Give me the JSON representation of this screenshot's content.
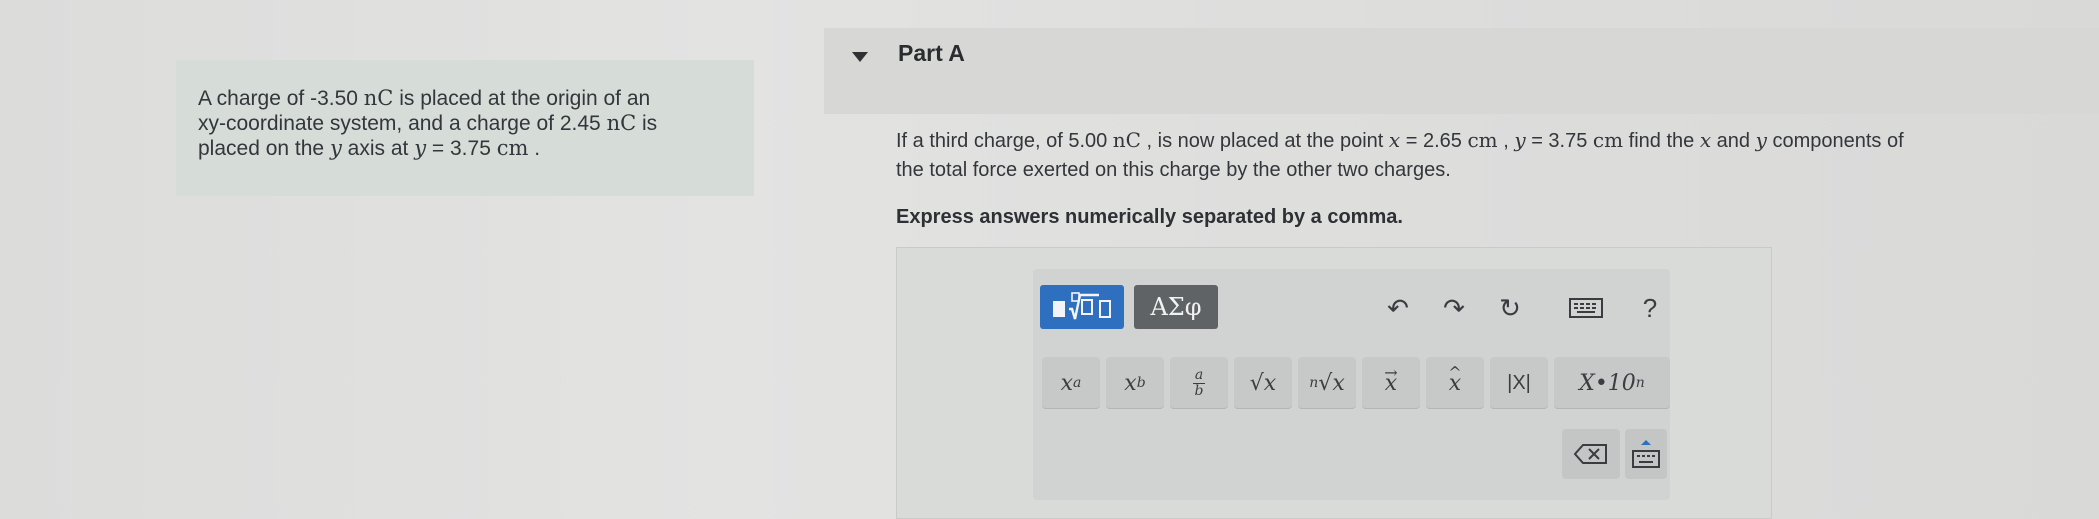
{
  "problem": {
    "line1_pre": "A charge of -3.50 ",
    "unit_nC": "nC",
    "line1_post": " is placed at the origin of an",
    "line2_pre": "xy-coordinate system, and a charge of 2.45 ",
    "line2_post": " is",
    "line3_pre": "placed on the ",
    "var_y": "y",
    "line3_mid": " axis at ",
    "line3_eq": " = 3.75 ",
    "unit_cm": "cm",
    "line3_end": " ."
  },
  "part": {
    "title": "Part A"
  },
  "question": {
    "q_pre": "If a third charge, of 5.00 ",
    "unit_nC": "nC",
    "q_mid1": " , is now placed at the point ",
    "var_x": "x",
    "q_eq1": " = 2.65 ",
    "unit_cm": "cm",
    "q_sep": " , ",
    "var_y": "y",
    "q_eq2": " = 3.75 ",
    "q_mid2": " find the ",
    "q_and": " and ",
    "q_end": " components of",
    "line2": "the total force exerted on this charge by the other two charges.",
    "instruction": "Express answers numerically separated by a comma."
  },
  "toolbar": {
    "greek_label": "ΑΣφ",
    "undo": "↶",
    "redo": "↷",
    "reset": "↻",
    "help": "?",
    "keys": {
      "superscript_base": "x",
      "superscript_exp": "a",
      "subscript_base": "x",
      "subscript_sub": "b",
      "frac_num": "a",
      "frac_den": "b",
      "sqrt": "√x",
      "nthroot_n": "n",
      "nthroot": "√x",
      "vector": "x",
      "unit_vector": "x",
      "abs": "|X|",
      "sci_base": "X•10",
      "sci_exp": "n"
    }
  }
}
